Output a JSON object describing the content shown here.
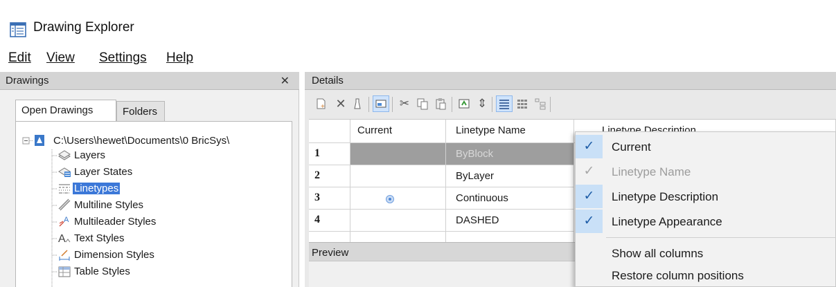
{
  "window": {
    "title": "Drawing Explorer"
  },
  "menu": [
    "Edit",
    "View",
    "Settings",
    "Help"
  ],
  "left_panel": {
    "header": "Drawings",
    "close_glyph": "✕",
    "tabs": [
      "Open Drawings",
      "Folders"
    ],
    "tree": {
      "root": "C:\\Users\\hewet\\Documents\\0 BricSys\\",
      "items": [
        "Layers",
        "Layer States",
        "Linetypes",
        "Multiline Styles",
        "Multileader Styles",
        "Text Styles",
        "Dimension Styles",
        "Table Styles"
      ],
      "selected": "Linetypes"
    }
  },
  "details": {
    "header": "Details",
    "columns": [
      "Current",
      "Linetype Name",
      "Linetype Description"
    ],
    "rows": [
      {
        "num": "1",
        "name": "ByBlock",
        "current": false
      },
      {
        "num": "2",
        "name": "ByLayer",
        "current": false
      },
      {
        "num": "3",
        "name": "Continuous",
        "current": true
      },
      {
        "num": "4",
        "name": "DASHED",
        "current": false
      }
    ],
    "selected_row": "1"
  },
  "preview": {
    "header": "Preview"
  },
  "context_menu": {
    "items": [
      {
        "label": "Current",
        "checked": true,
        "enabled": true
      },
      {
        "label": "Linetype Name",
        "checked": true,
        "enabled": false
      },
      {
        "label": "Linetype Description",
        "checked": true,
        "enabled": true
      },
      {
        "label": "Linetype Appearance",
        "checked": true,
        "enabled": true
      }
    ],
    "actions": [
      "Show all columns",
      "Restore column positions"
    ]
  },
  "colors": {
    "selection": "#3c78d8",
    "check_bg": "#c9e0f7",
    "row_selected": "#9e9e9e"
  }
}
